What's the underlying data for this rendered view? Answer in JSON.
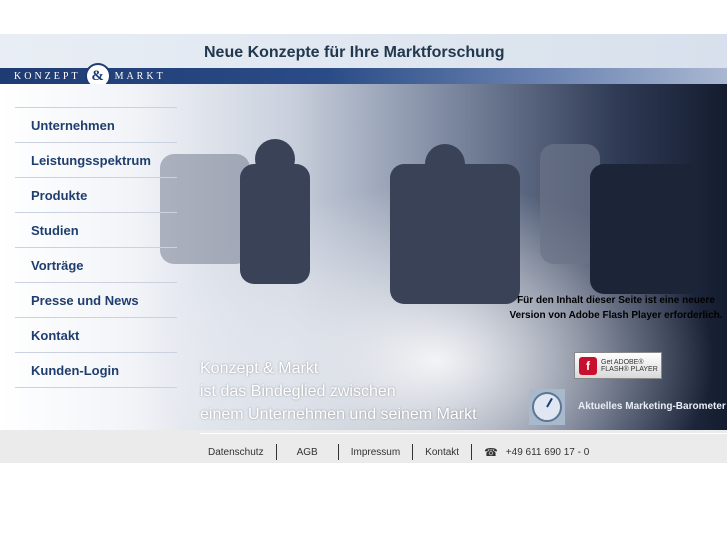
{
  "header": {
    "tagline": "Neue Konzepte für Ihre Marktforschung"
  },
  "logo": {
    "left": "KONZEPT",
    "amp": "&",
    "right": "MARKT"
  },
  "nav": [
    {
      "label": "Unternehmen"
    },
    {
      "label": "Leistungsspektrum"
    },
    {
      "label": "Produkte"
    },
    {
      "label": "Studien"
    },
    {
      "label": "Vorträge"
    },
    {
      "label": "Presse und News"
    },
    {
      "label": "Kontakt"
    },
    {
      "label": "Kunden-Login"
    }
  ],
  "claim": {
    "line1": "Konzept & Markt",
    "line2": "ist das Bindeglied zwischen",
    "line3": "einem Unternehmen und seinem Markt"
  },
  "flash": {
    "notice": "Für den Inhalt dieser Seite ist eine neuere Version von Adobe Flash Player erforderlich.",
    "button_top": "Get ADOBE®",
    "button_bottom": "FLASH® PLAYER"
  },
  "barometer": {
    "label": "Aktuelles Marketing-Barometer",
    "icon": "barometer-icon"
  },
  "footer": {
    "links": [
      "Datenschutz",
      "AGB",
      "Impressum",
      "Kontakt"
    ],
    "phone_icon": "phone-icon",
    "phone": "+49 611 690 17 - 0"
  }
}
